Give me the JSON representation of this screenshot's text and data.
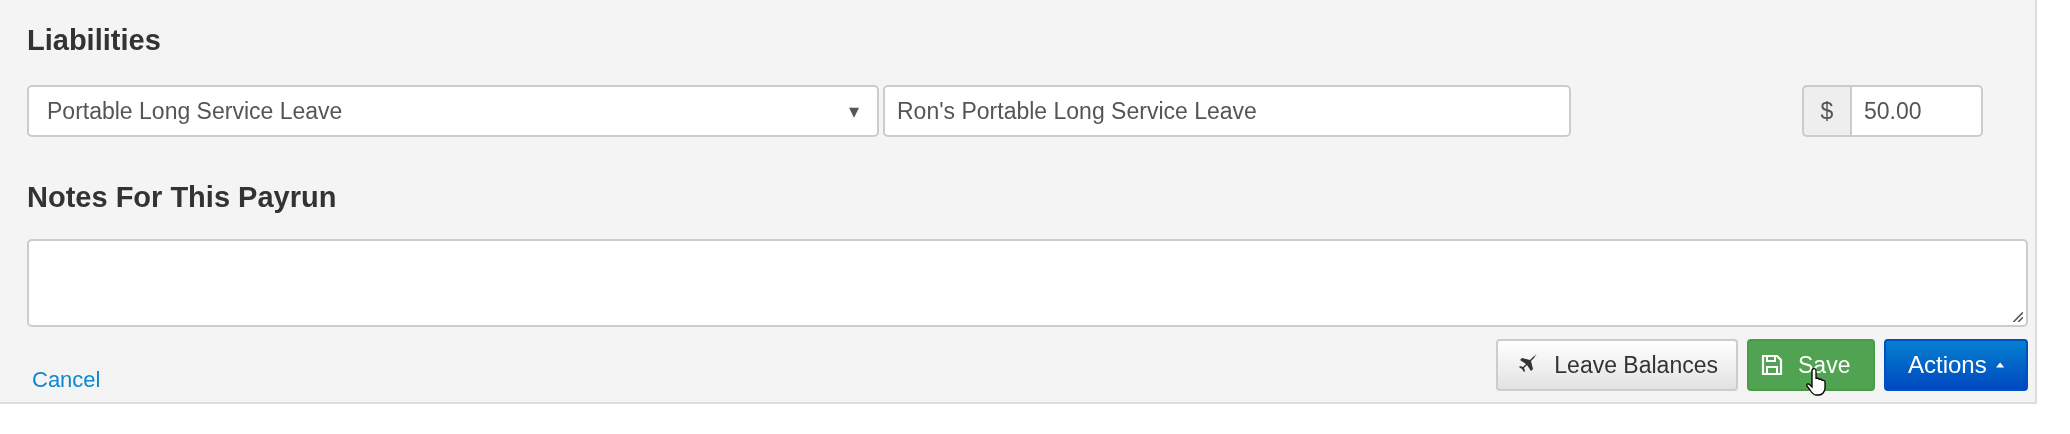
{
  "liabilities": {
    "heading": "Liabilities",
    "row": {
      "type_select": {
        "value": "Portable Long Service Leave",
        "caret": "▾"
      },
      "description": {
        "value": "Ron's Portable Long Service Leave"
      },
      "currency": "$",
      "amount": {
        "value": "50.00"
      }
    }
  },
  "notes": {
    "heading": "Notes For This Payrun"
  },
  "footer": {
    "cancel": "Cancel",
    "buttons": [
      {
        "kind": "default",
        "label": "Leave Balances"
      },
      {
        "kind": "success",
        "label": "Save",
        "hovered": true
      },
      {
        "kind": "primary",
        "label": "Actions"
      }
    ]
  }
}
